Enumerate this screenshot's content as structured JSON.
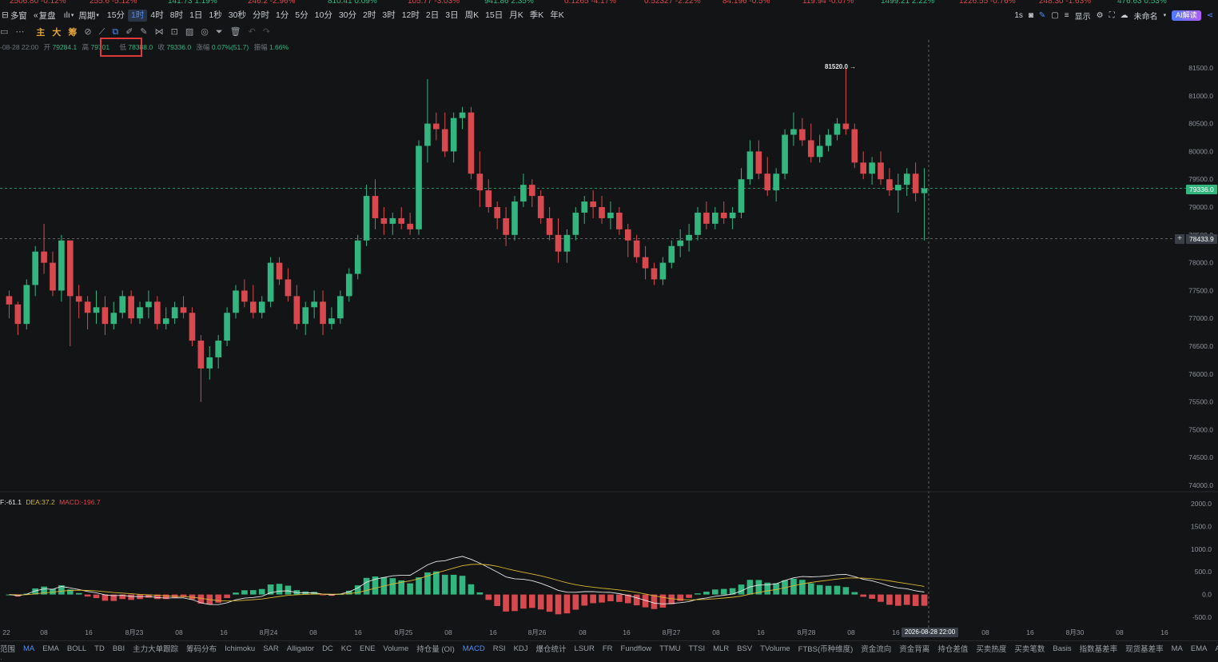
{
  "ticker": [
    {
      "text": "2506.80 -0.12%",
      "color": "#d8494f"
    },
    {
      "text": "255.6 -5.12%",
      "color": "#d8494f"
    },
    {
      "text": "141.73 1.19%",
      "color": "#33b57f"
    },
    {
      "text": "246.2 -2.96%",
      "color": "#d8494f"
    },
    {
      "text": "810.41 0.09%",
      "color": "#33b57f"
    },
    {
      "text": "105.77 -3.03%",
      "color": "#d8494f"
    },
    {
      "text": "941.86 2.35%",
      "color": "#33b57f"
    },
    {
      "text": "0.1265 -4.17%",
      "color": "#d8494f"
    },
    {
      "text": "0.52327 -2.22%",
      "color": "#d8494f"
    },
    {
      "text": "84.196 -0.5%",
      "color": "#d8494f"
    },
    {
      "text": "119.94 -0.07%",
      "color": "#d8494f"
    },
    {
      "text": "1499.21 2.22%",
      "color": "#33b57f"
    },
    {
      "text": "1226.55 -0.76%",
      "color": "#d8494f"
    },
    {
      "text": "248.30 -1.63%",
      "color": "#d8494f"
    },
    {
      "text": "476.63 0.53%",
      "color": "#33b57f"
    }
  ],
  "topbar": {
    "multi_window": "多窗",
    "replay": "复盘",
    "period_label": "周期",
    "timeframes": [
      "15分",
      "1时",
      "4时",
      "8时",
      "1日",
      "1秒",
      "30秒",
      "分时",
      "1分",
      "5分",
      "10分",
      "30分",
      "2时",
      "3时",
      "12时",
      "2日",
      "3日",
      "周K",
      "15日",
      "月K",
      "季K",
      "年K"
    ],
    "active_timeframe": "1时",
    "right_1s": "1s",
    "display": "显示",
    "unnamed": "未命名",
    "ai_button": "AI解读"
  },
  "toolbar2": {
    "main": "主",
    "big": "大",
    "chips": "筹"
  },
  "infoline": {
    "datetime": "-08-28 22:00",
    "open_label": "开",
    "open": "79284.1",
    "high_label": "高",
    "high": "79701",
    "low_label": "低",
    "low": "78388.0",
    "close_label": "收",
    "close": "79336.0",
    "change_label": "涨幅",
    "change": "0.07%(51.7)",
    "amp_label": "振幅",
    "amp": "1.66%"
  },
  "price_axis": [
    "81500.0",
    "81000.0",
    "80500.0",
    "80000.0",
    "79500.0",
    "79000.0",
    "78500.0",
    "78000.0",
    "77500.0",
    "77000.0",
    "76500.0",
    "76000.0",
    "75500.0",
    "75000.0",
    "74500.0",
    "74000.0"
  ],
  "macd_axis": [
    "2000.0",
    "1500.0",
    "1000.0",
    "500.0",
    "0.0",
    "-500.0"
  ],
  "time_axis": [
    {
      "label": "22"
    },
    {
      "label": "08"
    },
    {
      "label": "16"
    },
    {
      "label": "8月23"
    },
    {
      "label": "08"
    },
    {
      "label": "16"
    },
    {
      "label": "8月24"
    },
    {
      "label": "08"
    },
    {
      "label": "16"
    },
    {
      "label": "8月25"
    },
    {
      "label": "08"
    },
    {
      "label": "16"
    },
    {
      "label": "8月26"
    },
    {
      "label": "08"
    },
    {
      "label": "16"
    },
    {
      "label": "8月27"
    },
    {
      "label": "08"
    },
    {
      "label": "16"
    },
    {
      "label": "8月28"
    },
    {
      "label": "08"
    },
    {
      "label": "16"
    },
    {
      "label": "08"
    },
    {
      "label": "16"
    },
    {
      "label": "8月30"
    },
    {
      "label": "08"
    },
    {
      "label": "16"
    }
  ],
  "crosshair_time": "2026-08-28 22:00",
  "last_price_tag": "79336.0",
  "cursor_price_tag": "78433.9",
  "max_price_label": "81520.0",
  "macd_legend": {
    "dif": "F:-61.1",
    "dea": "DEA:37.2",
    "macd": "MACD:-196.7"
  },
  "bottom_tabs": [
    "范围",
    "MA",
    "EMA",
    "BOLL",
    "TD",
    "BBI",
    "主力大单跟踪",
    "筹码分布",
    "Ichimoku",
    "SAR",
    "Alligator",
    "DC",
    "KC",
    "ENE",
    "Volume",
    "持仓量 (OI)",
    "MACD",
    "RSI",
    "KDJ",
    "爆仓统计",
    "LSUR",
    "FR",
    "Fundflow",
    "TTMU",
    "TTSI",
    "MLR",
    "BSV",
    "TVolume",
    "FTBS(币种维度)",
    "资金流向",
    "资金背离",
    "持仓差值",
    "买卖热度",
    "买卖笔数",
    "Basis",
    "指数基差率",
    "现货基差率",
    "MA",
    "EMA",
    "AO",
    "社区指标",
    "对数",
    "%",
    "自动"
  ],
  "colors": {
    "up": "#33b57f",
    "down": "#d8494f",
    "dif": "#e6e6e6",
    "dea": "#d7b733",
    "background": "#131416",
    "accent": "#4e8cff"
  },
  "chart_data": {
    "type": "candlestick",
    "title": "",
    "timeframe": "1时",
    "y_range": [
      73800,
      81800
    ],
    "candles_ohlc": [
      [
        77400,
        77500,
        77000,
        77250
      ],
      [
        77250,
        77300,
        76700,
        76900
      ],
      [
        76900,
        77700,
        76800,
        77600
      ],
      [
        77600,
        78300,
        77400,
        78200
      ],
      [
        78200,
        78700,
        77800,
        78000
      ],
      [
        78000,
        78200,
        77400,
        77500
      ],
      [
        77500,
        78500,
        77300,
        78400
      ],
      [
        78400,
        78400,
        76500,
        77400
      ],
      [
        77400,
        77600,
        77000,
        77300
      ],
      [
        77300,
        77400,
        76800,
        77100
      ],
      [
        77100,
        77500,
        76900,
        77200
      ],
      [
        77200,
        77400,
        76700,
        76900
      ],
      [
        76900,
        77300,
        76800,
        77100
      ],
      [
        77100,
        77500,
        77000,
        77400
      ],
      [
        77400,
        77500,
        76900,
        77000
      ],
      [
        77000,
        77300,
        76900,
        77200
      ],
      [
        77200,
        77500,
        77000,
        77300
      ],
      [
        77300,
        77400,
        76800,
        76900
      ],
      [
        76900,
        77200,
        76800,
        77000
      ],
      [
        77000,
        77300,
        76900,
        77200
      ],
      [
        77200,
        77400,
        77000,
        77100
      ],
      [
        77100,
        77200,
        76500,
        76600
      ],
      [
        76600,
        76700,
        75500,
        76100
      ],
      [
        76100,
        76500,
        75900,
        76300
      ],
      [
        76300,
        76700,
        76100,
        76600
      ],
      [
        76600,
        77200,
        76500,
        77100
      ],
      [
        77100,
        77600,
        77000,
        77500
      ],
      [
        77500,
        77700,
        77200,
        77300
      ],
      [
        77300,
        77600,
        77000,
        77100
      ],
      [
        77100,
        77400,
        77000,
        77300
      ],
      [
        77300,
        78100,
        77200,
        78000
      ],
      [
        78000,
        78100,
        77600,
        77700
      ],
      [
        77700,
        77900,
        77300,
        77400
      ],
      [
        77400,
        77600,
        76800,
        76900
      ],
      [
        76900,
        77300,
        76700,
        77200
      ],
      [
        77200,
        77500,
        77000,
        77300
      ],
      [
        77300,
        77500,
        76700,
        76900
      ],
      [
        76900,
        77200,
        76800,
        77000
      ],
      [
        77000,
        77500,
        76900,
        77400
      ],
      [
        77400,
        77900,
        77300,
        77800
      ],
      [
        77800,
        78500,
        77700,
        78400
      ],
      [
        78400,
        79400,
        78300,
        79200
      ],
      [
        79200,
        79500,
        78600,
        78800
      ],
      [
        78800,
        79000,
        78500,
        78700
      ],
      [
        78700,
        78900,
        78500,
        78800
      ],
      [
        78800,
        79000,
        78600,
        78700
      ],
      [
        78700,
        78900,
        78500,
        78600
      ],
      [
        78600,
        80200,
        78500,
        80100
      ],
      [
        80100,
        81300,
        79800,
        80500
      ],
      [
        80500,
        80700,
        80200,
        80400
      ],
      [
        80400,
        80700,
        79900,
        80000
      ],
      [
        80000,
        80700,
        79800,
        80600
      ],
      [
        80600,
        80800,
        80400,
        80700
      ],
      [
        80700,
        80800,
        79500,
        79600
      ],
      [
        79600,
        80000,
        79000,
        79300
      ],
      [
        79300,
        79500,
        78900,
        79000
      ],
      [
        79000,
        79100,
        78600,
        78800
      ],
      [
        78800,
        79000,
        78300,
        78500
      ],
      [
        78500,
        79200,
        78400,
        79100
      ],
      [
        79100,
        79600,
        79000,
        79400
      ],
      [
        79400,
        79500,
        79000,
        79200
      ],
      [
        79200,
        79300,
        78700,
        78800
      ],
      [
        78800,
        79000,
        78400,
        78500
      ],
      [
        78500,
        78800,
        78000,
        78200
      ],
      [
        78200,
        78600,
        78000,
        78500
      ],
      [
        78500,
        79000,
        78400,
        78900
      ],
      [
        78900,
        79200,
        78700,
        79100
      ],
      [
        79100,
        79300,
        78800,
        79000
      ],
      [
        79000,
        79200,
        78700,
        78800
      ],
      [
        78800,
        79100,
        78600,
        78900
      ],
      [
        78900,
        79000,
        78500,
        78600
      ],
      [
        78600,
        78700,
        78100,
        78400
      ],
      [
        78400,
        78500,
        78000,
        78100
      ],
      [
        78100,
        78300,
        77700,
        77900
      ],
      [
        77900,
        78000,
        77600,
        77700
      ],
      [
        77700,
        78100,
        77600,
        78000
      ],
      [
        78000,
        78400,
        77900,
        78300
      ],
      [
        78300,
        78600,
        78100,
        78400
      ],
      [
        78400,
        78700,
        78200,
        78500
      ],
      [
        78500,
        79000,
        78400,
        78900
      ],
      [
        78900,
        79100,
        78600,
        78700
      ],
      [
        78700,
        79000,
        78600,
        78900
      ],
      [
        78900,
        79100,
        78700,
        78800
      ],
      [
        78800,
        79000,
        78600,
        78900
      ],
      [
        78900,
        79700,
        78800,
        79500
      ],
      [
        79500,
        80200,
        79400,
        80000
      ],
      [
        80000,
        80200,
        79500,
        79600
      ],
      [
        79600,
        79900,
        79200,
        79300
      ],
      [
        79300,
        79700,
        79100,
        79600
      ],
      [
        79600,
        80400,
        79500,
        80300
      ],
      [
        80300,
        80700,
        80100,
        80400
      ],
      [
        80400,
        80600,
        80100,
        80200
      ],
      [
        80200,
        80500,
        79800,
        79900
      ],
      [
        79900,
        80300,
        79800,
        80100
      ],
      [
        80100,
        80400,
        80000,
        80300
      ],
      [
        80300,
        80600,
        80200,
        80500
      ],
      [
        80500,
        81500,
        80300,
        80400
      ],
      [
        80400,
        80500,
        79700,
        79800
      ],
      [
        79800,
        80000,
        79500,
        79600
      ],
      [
        79600,
        79900,
        79400,
        79800
      ],
      [
        79800,
        80000,
        79400,
        79500
      ],
      [
        79500,
        79700,
        79200,
        79300
      ],
      [
        79300,
        79600,
        78900,
        79400
      ],
      [
        79400,
        79700,
        79200,
        79600
      ],
      [
        79600,
        79800,
        79100,
        79250
      ],
      [
        79250,
        79700,
        78400,
        79336
      ]
    ]
  }
}
